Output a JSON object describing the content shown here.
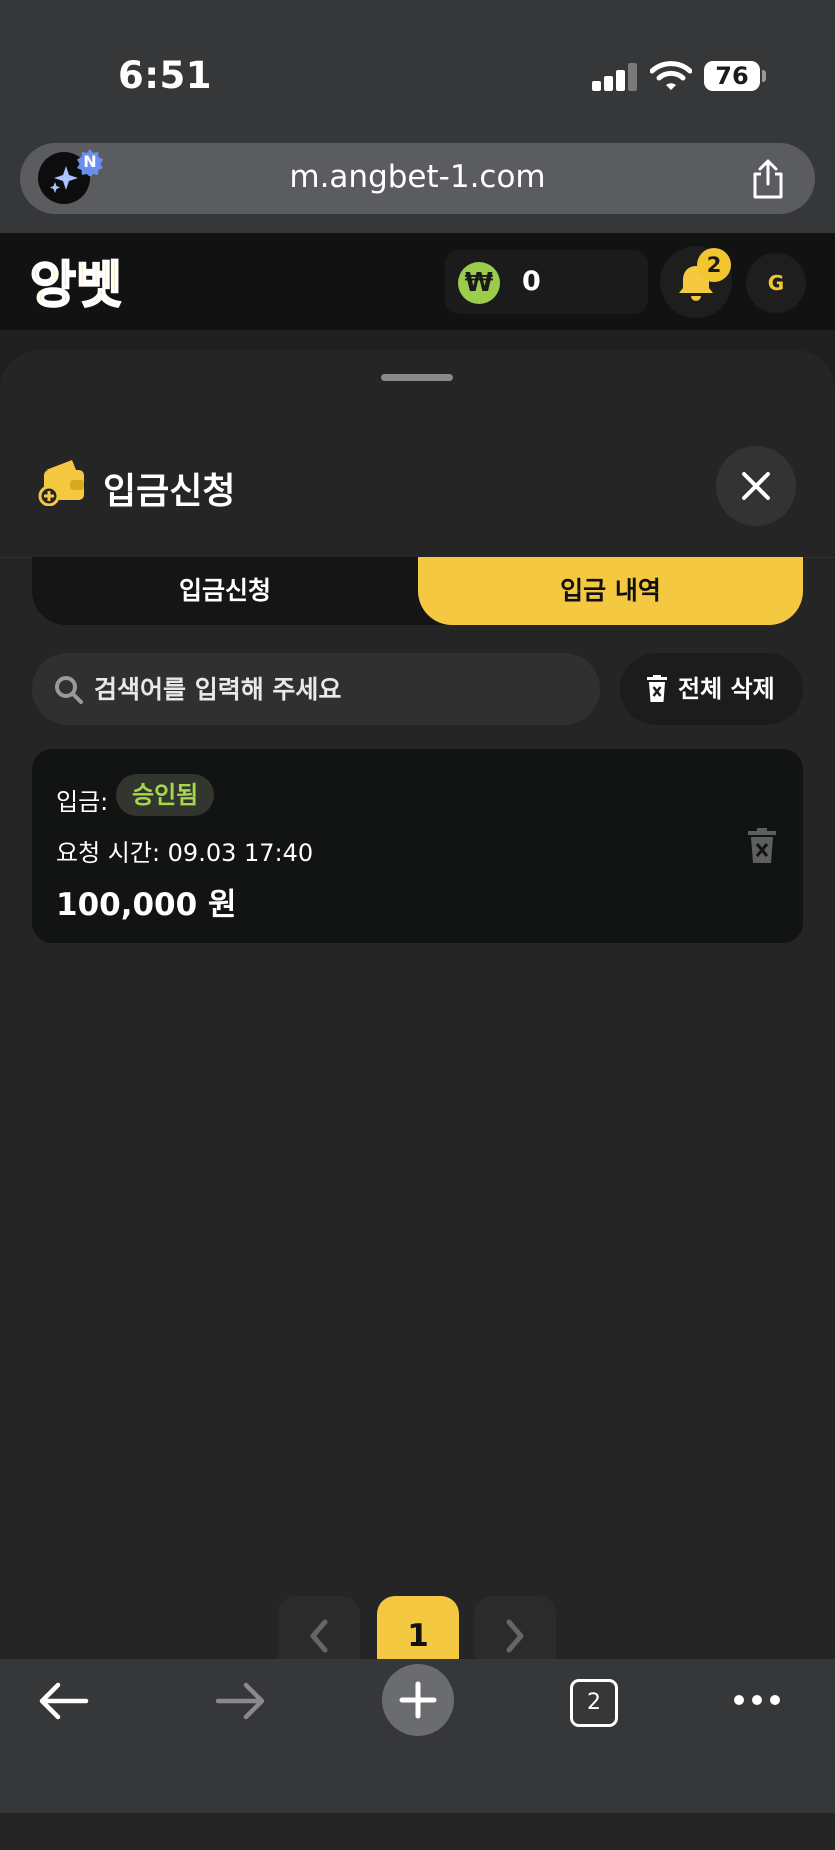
{
  "status_bar": {
    "time": "6:51",
    "battery": "76"
  },
  "browser": {
    "url": "m.angbet-1.com",
    "badge": "N",
    "tabs_count": "2"
  },
  "header": {
    "logo": "앙벳",
    "currency_symbol": "₩",
    "balance": "0",
    "notification_count": "2",
    "avatar_initial": "G"
  },
  "sheet": {
    "title": "입금신청",
    "tabs": [
      {
        "label": "입금신청",
        "active": false
      },
      {
        "label": "입금 내역",
        "active": true
      }
    ],
    "search": {
      "placeholder": "검색어를 입력해 주세요",
      "value": ""
    },
    "delete_all_label": "전체 삭제",
    "records": [
      {
        "type_label": "입금:",
        "status": "승인됨",
        "time": "요청 시간: 09.03 17:40",
        "amount": "100,000 원"
      }
    ]
  },
  "pagination": {
    "current": "1"
  },
  "colors": {
    "accent": "#f5c842",
    "status_approved": "#a4d84a",
    "won_green": "#9ccc4c"
  }
}
